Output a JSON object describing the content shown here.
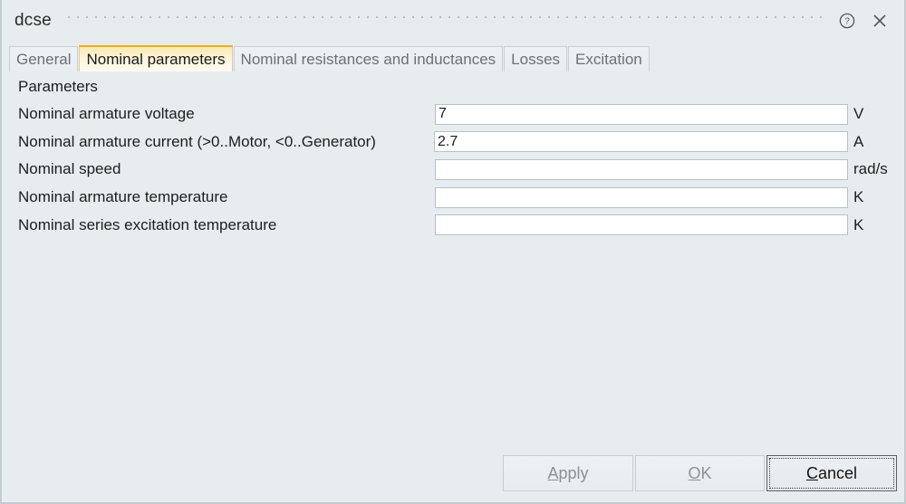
{
  "window": {
    "title": "dcse",
    "help_icon": "help-circle-icon",
    "close_icon": "close-icon"
  },
  "tabs": [
    {
      "label": "General",
      "active": false
    },
    {
      "label": "Nominal parameters",
      "active": true
    },
    {
      "label": "Nominal resistances and inductances",
      "active": false
    },
    {
      "label": "Losses",
      "active": false
    },
    {
      "label": "Excitation",
      "active": false
    }
  ],
  "form": {
    "section_title": "Parameters",
    "rows": [
      {
        "label": "Nominal armature voltage",
        "value": "7",
        "placeholder": "",
        "unit": "V"
      },
      {
        "label": "Nominal armature current (>0..Motor, <0..Generator)",
        "value": "2.7",
        "placeholder": "",
        "unit": "A"
      },
      {
        "label": "Nominal speed",
        "value": "",
        "placeholder": "",
        "unit": "rad/s"
      },
      {
        "label": "Nominal armature temperature",
        "value": "",
        "placeholder": "",
        "unit": "K"
      },
      {
        "label": "Nominal series excitation temperature",
        "value": "",
        "placeholder": "",
        "unit": "K"
      }
    ]
  },
  "buttons": {
    "apply": {
      "label": "Apply",
      "mnemonic": "A",
      "rest": "pply",
      "enabled": false,
      "focused": false
    },
    "ok": {
      "label": "OK",
      "mnemonic": "O",
      "rest": "K",
      "enabled": false,
      "focused": false
    },
    "cancel": {
      "label": "Cancel",
      "mnemonic": "C",
      "rest": "ancel",
      "enabled": true,
      "focused": true
    }
  },
  "colors": {
    "background": "#e7ecef",
    "active_tab_accent": "#f0ad23",
    "field_border": "#b8c0c6",
    "text": "#1e1e1e",
    "disabled_text": "#8b9197"
  }
}
